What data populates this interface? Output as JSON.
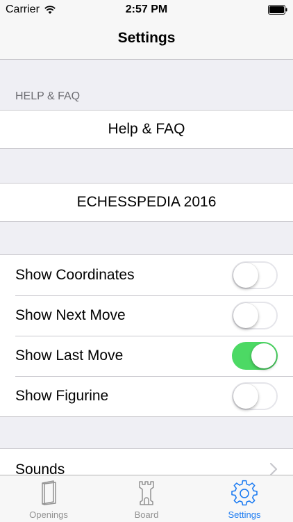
{
  "status_bar": {
    "carrier": "Carrier",
    "time": "2:57 PM"
  },
  "nav": {
    "title": "Settings"
  },
  "sections": {
    "help_header": "HELP & FAQ",
    "help_cell": "Help & FAQ",
    "about_cell": "ECHESSPEDIA 2016"
  },
  "toggles": [
    {
      "label": "Show Coordinates",
      "on": false
    },
    {
      "label": "Show Next Move",
      "on": false
    },
    {
      "label": "Show Last Move",
      "on": true
    },
    {
      "label": "Show Figurine",
      "on": false
    }
  ],
  "sounds": {
    "label": "Sounds"
  },
  "tabs": [
    {
      "label": "Openings",
      "icon": "book-icon",
      "active": false
    },
    {
      "label": "Board",
      "icon": "rook-icon",
      "active": false
    },
    {
      "label": "Settings",
      "icon": "gear-icon",
      "active": true
    }
  ],
  "colors": {
    "accent": "#1d7cf2",
    "switch_on": "#4cd964",
    "background": "#efeff4"
  }
}
